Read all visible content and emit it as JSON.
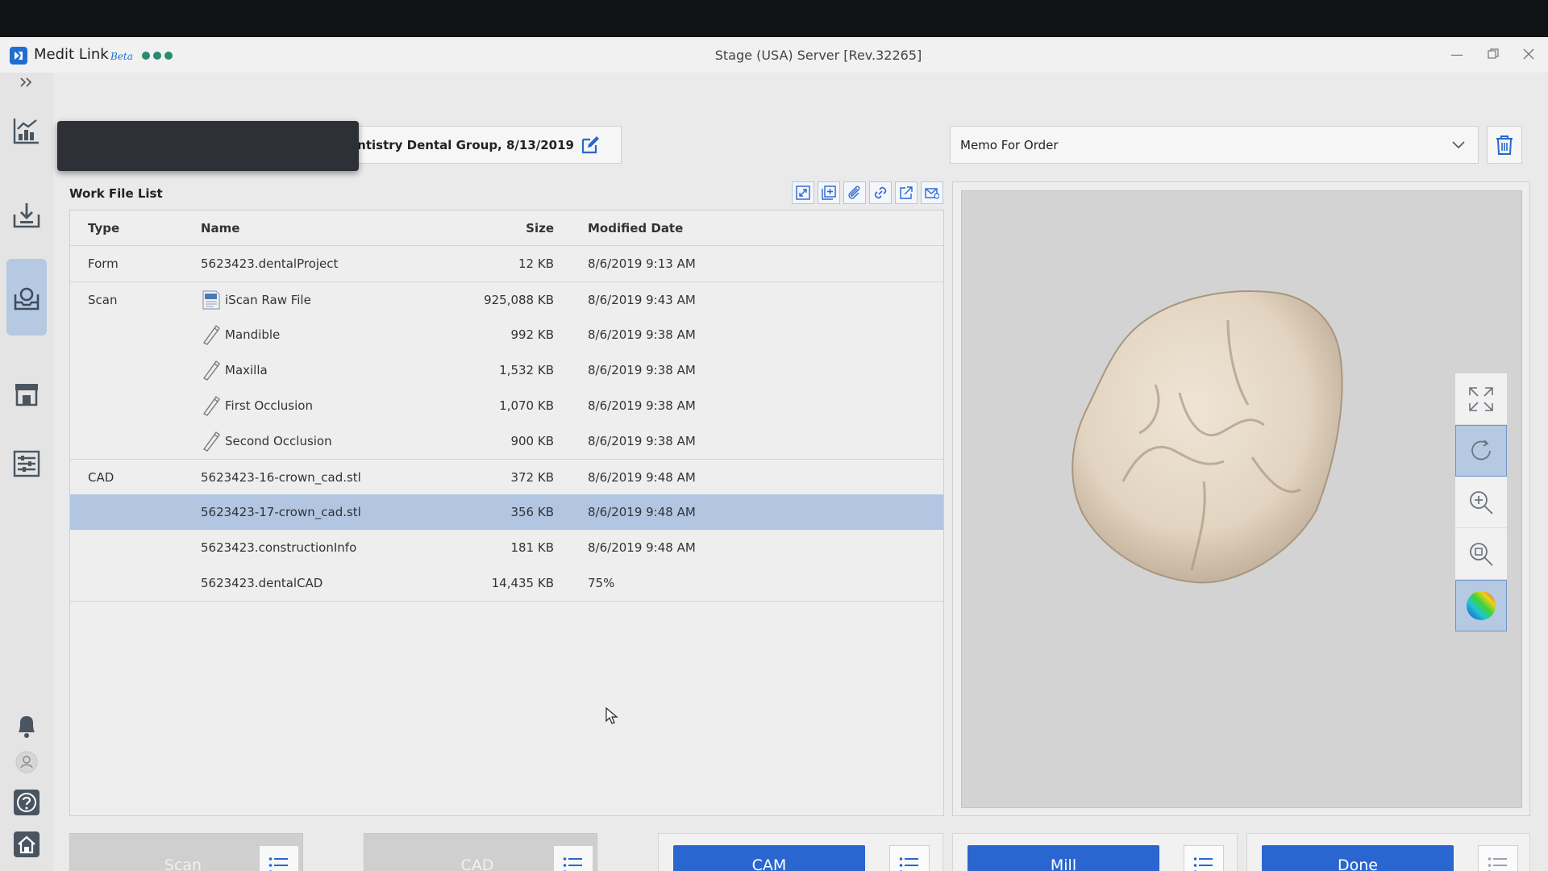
{
  "app": {
    "name": "Medit Link",
    "beta": "Beta",
    "window_title": "Stage (USA) Server [Rev.32265]"
  },
  "order": {
    "info": "entistry Dental Group, 8/13/2019"
  },
  "memo": {
    "selected": "Memo For Order"
  },
  "work_file_list": {
    "title": "Work File List",
    "columns": {
      "type": "Type",
      "name": "Name",
      "size": "Size",
      "date": "Modified Date"
    },
    "rows": [
      {
        "type": "Form",
        "name": "5623423.dentalProject",
        "size": "12 KB",
        "date": "8/6/2019 9:13 AM"
      },
      {
        "type": "Scan",
        "name": "iScan Raw File",
        "size": "925,088 KB",
        "date": "8/6/2019 9:43 AM"
      },
      {
        "type": "",
        "name": "Mandible",
        "size": "992 KB",
        "date": "8/6/2019 9:38 AM"
      },
      {
        "type": "",
        "name": "Maxilla",
        "size": "1,532 KB",
        "date": "8/6/2019 9:38 AM"
      },
      {
        "type": "",
        "name": "First Occlusion",
        "size": "1,070 KB",
        "date": "8/6/2019 9:38 AM"
      },
      {
        "type": "",
        "name": "Second Occlusion",
        "size": "900 KB",
        "date": "8/6/2019 9:38 AM"
      },
      {
        "type": "CAD",
        "name": "5623423-16-crown_cad.stl",
        "size": "372 KB",
        "date": "8/6/2019 9:48 AM"
      },
      {
        "type": "",
        "name": "5623423-17-crown_cad.stl",
        "size": "356 KB",
        "date": "8/6/2019 9:48 AM"
      },
      {
        "type": "",
        "name": "5623423.constructionInfo",
        "size": "181 KB",
        "date": "8/6/2019 9:48 AM"
      },
      {
        "type": "",
        "name": "5623423.dentalCAD",
        "size": "14,435 KB",
        "date": "75%"
      }
    ]
  },
  "stages": {
    "scan": "Scan",
    "cad": "CAD",
    "cam": "CAM",
    "mill": "Mill",
    "done": "Done"
  },
  "colors": {
    "accent": "#2a66cf",
    "selected_row": "#b2c6e2",
    "tooth": "#e8dccb"
  }
}
